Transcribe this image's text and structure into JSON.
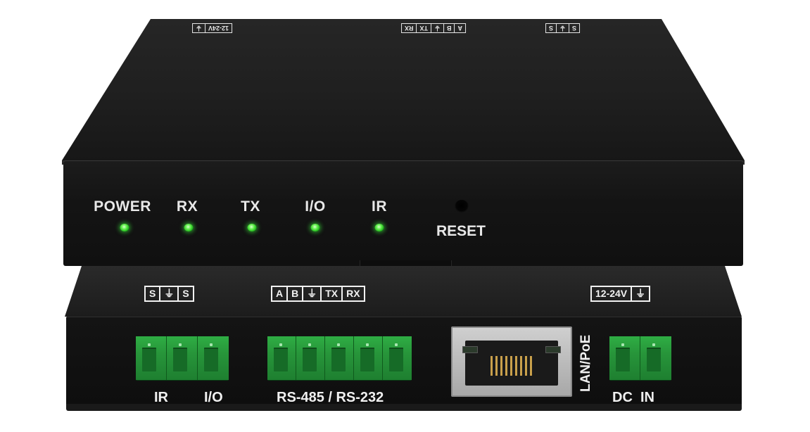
{
  "top_unit": {
    "leds": [
      {
        "label": "POWER",
        "color": "#3ce63c"
      },
      {
        "label": "RX",
        "color": "#3ce63c"
      },
      {
        "label": "TX",
        "color": "#3ce63c"
      },
      {
        "label": "I/O",
        "color": "#3ce63c"
      },
      {
        "label": "IR",
        "color": "#3ce63c"
      }
    ],
    "reset_label": "RESET",
    "lid_labels": {
      "power": [
        "12-24V",
        "⏚"
      ],
      "serial": [
        "A",
        "B",
        "⏚",
        "TX",
        "RX"
      ],
      "ir": [
        "S",
        "⏚",
        "S"
      ]
    }
  },
  "bottom_unit": {
    "ir_io_pins": [
      "S",
      "⏚",
      "S"
    ],
    "serial_pins": [
      "A",
      "B",
      "⏚",
      "TX",
      "RX"
    ],
    "power_pins": [
      "12-24V",
      "⏚"
    ],
    "captions": {
      "ir": "IR",
      "io": "I/O",
      "serial": "RS-485 / RS-232",
      "lan": "LAN/PoE",
      "dc_in": "DC  IN"
    }
  },
  "colors": {
    "chassis": "#141414",
    "terminal_green": "#27953a",
    "led_green": "#3ce63c",
    "silkscreen": "#f2f2f2"
  }
}
